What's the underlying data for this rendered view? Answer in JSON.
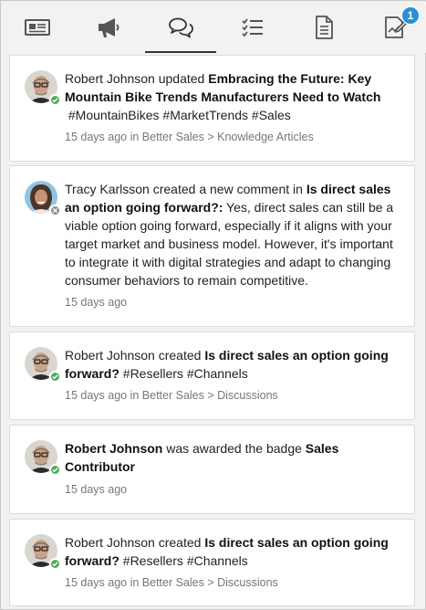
{
  "tabs": [
    {
      "icon": "newspaper-icon",
      "active": false
    },
    {
      "icon": "megaphone-icon",
      "active": false
    },
    {
      "icon": "chat-bubbles-icon",
      "active": true
    },
    {
      "icon": "checklist-icon",
      "active": false
    },
    {
      "icon": "document-icon",
      "active": false
    },
    {
      "icon": "edit-document-icon",
      "active": false,
      "badge": "1"
    }
  ],
  "colors": {
    "accent": "#2b8fd8",
    "online": "#4cb04f",
    "offline": "#8c8c8c"
  },
  "feed": [
    {
      "user": "Robert Johnson",
      "status": "online",
      "action": " updated ",
      "title": "Embracing the Future: Key Mountain Bike Trends Manufacturers Need to Watch",
      "tags": [
        "#MountainBikes",
        "#MarketTrends",
        "#Sales"
      ],
      "meta": "15 days ago in Better Sales > Knowledge Articles"
    },
    {
      "user": "Tracy Karlsson",
      "status": "offline",
      "action": " created a new comment in ",
      "title": "Is direct sales an option going forward?:",
      "excerpt": " Yes, direct sales can still be a viable option going forward, especially if it aligns with your target market and business model. However, it's important to integrate it with digital strategies and adapt to changing consumer behaviors to remain competitive.",
      "meta": "15 days ago"
    },
    {
      "user": "Robert Johnson",
      "status": "online",
      "action": " created ",
      "title": "Is direct sales an option going forward?",
      "tags": [
        "#Resellers",
        "#Channels"
      ],
      "meta": "15 days ago in Better Sales > Discussions"
    },
    {
      "user": "Robert Johnson",
      "status": "online",
      "action": " was awarded the badge ",
      "title": "Sales Contributor",
      "meta": "15 days ago"
    },
    {
      "user": "Robert Johnson",
      "status": "online",
      "action": " created ",
      "title": "Is direct sales an option going forward?",
      "tags": [
        "#Resellers",
        "#Channels"
      ],
      "meta": "15 days ago in Better Sales > Discussions"
    }
  ]
}
